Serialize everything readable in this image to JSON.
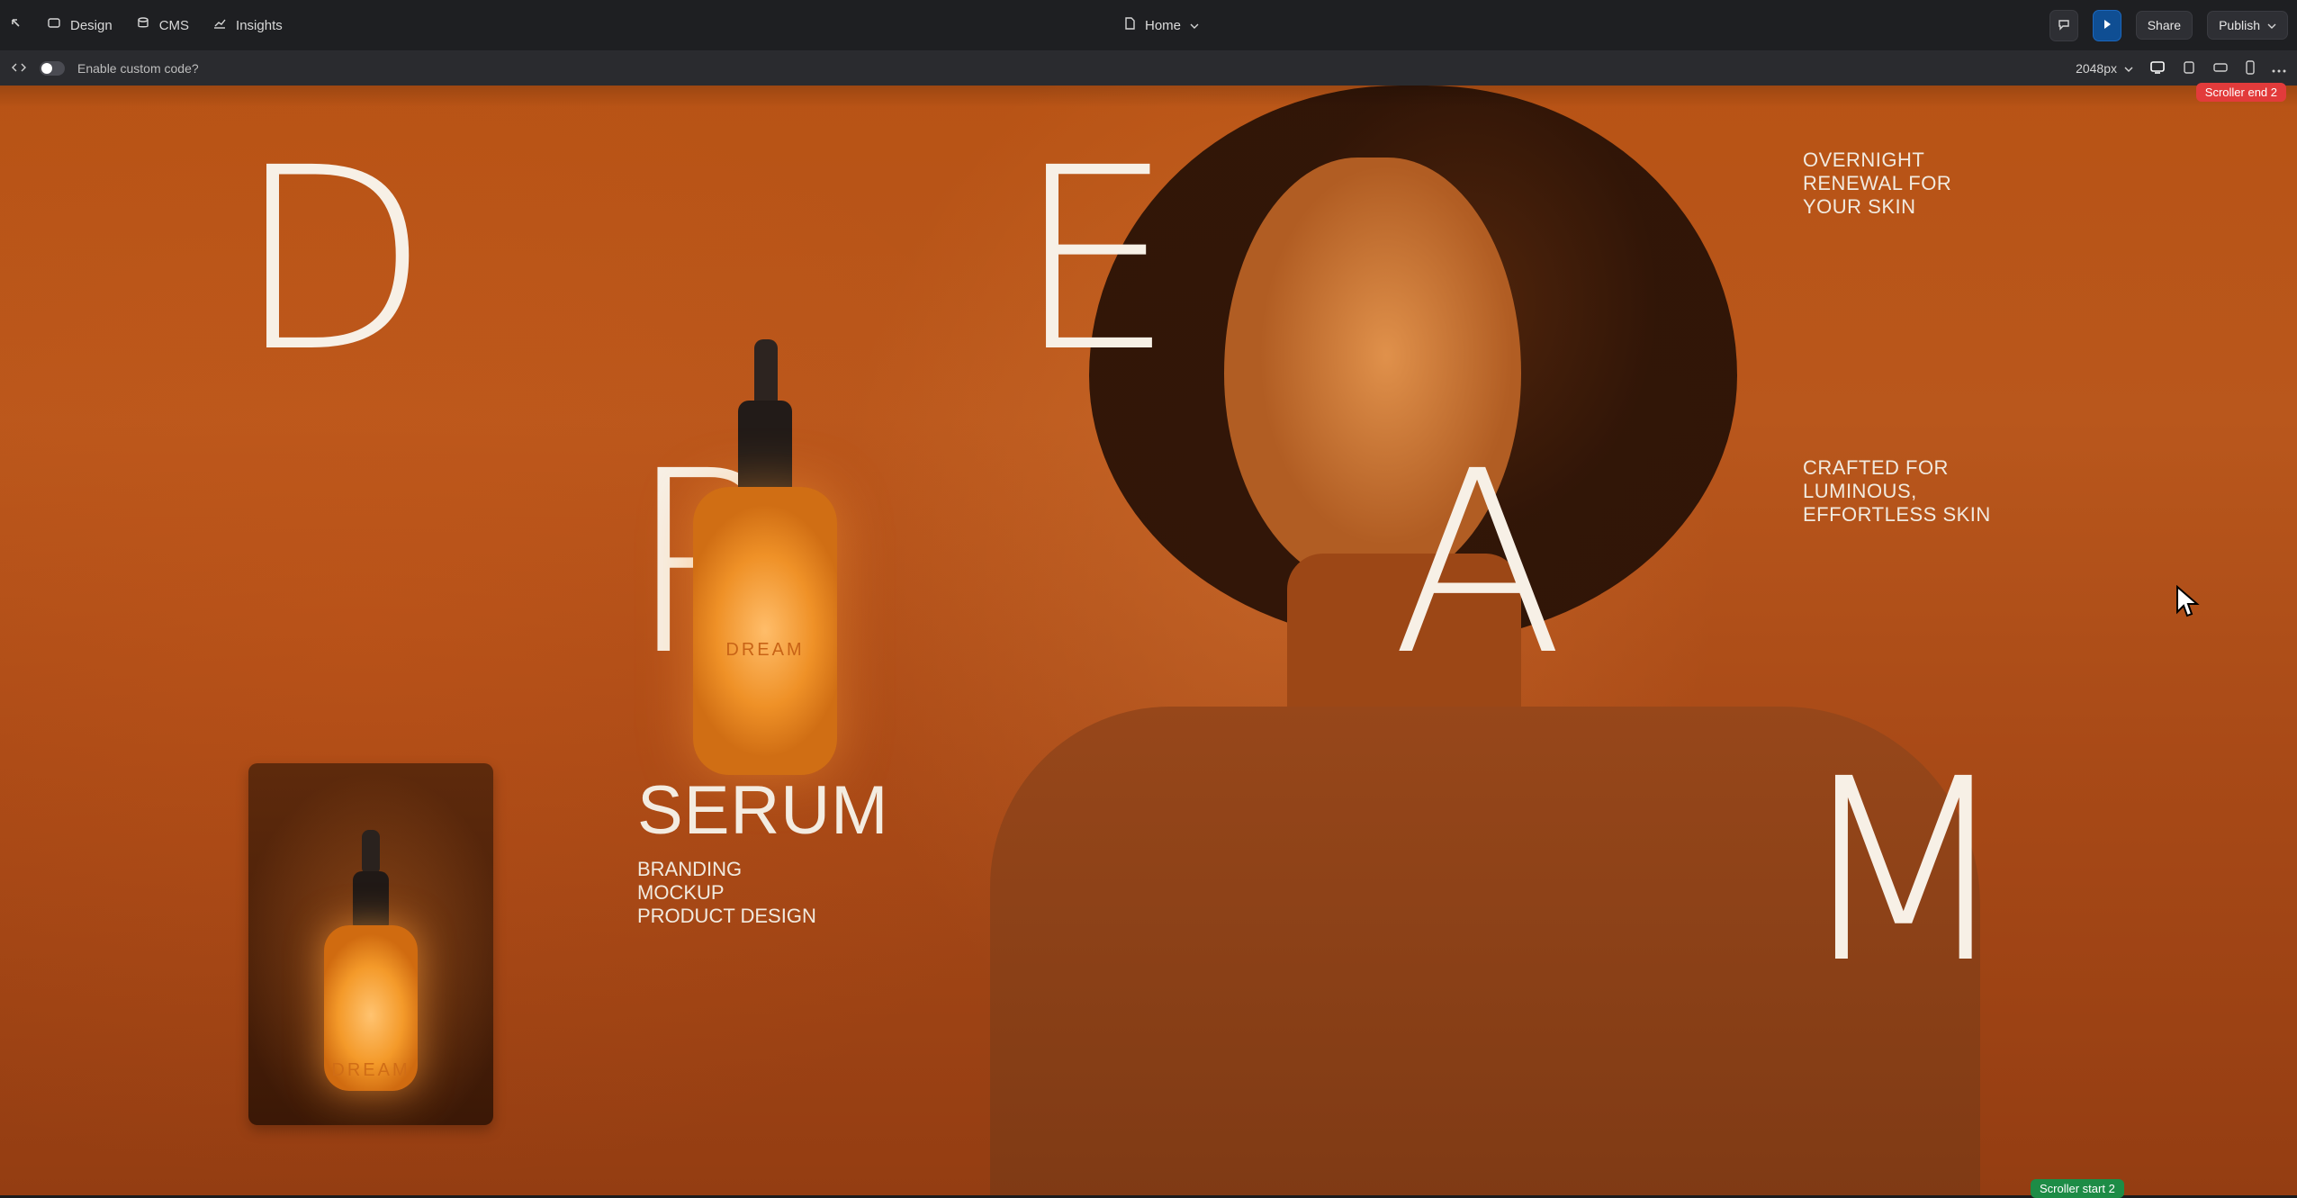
{
  "toolbar": {
    "design_label": "Design",
    "cms_label": "CMS",
    "insights_label": "Insights",
    "page_label": "Home",
    "share_label": "Share",
    "publish_label": "Publish"
  },
  "subbar": {
    "custom_code_label": "Enable custom code?",
    "breakpoint": "2048px"
  },
  "canvas": {
    "letters": [
      "D",
      "E",
      "R",
      "A",
      "M"
    ],
    "tagline1": "OVERNIGHT\nRENEWAL FOR\nYOUR SKIN",
    "tagline2": "CRAFTED FOR\nLUMINOUS,\nEFFORTLESS SKIN",
    "serum_title": "SERUM",
    "serum_lines": [
      "BRANDING",
      "MOCKUP",
      "PRODUCT DESIGN"
    ],
    "bottle_label": "DREAM",
    "hand_bottle_label": "DREAM"
  },
  "tags": {
    "scroller_end": "Scroller end 2",
    "scroller_start": "Scroller start 2"
  },
  "icons": {
    "back": "arrow-up-left-icon",
    "design": "layout-icon",
    "cms": "database-icon",
    "insights": "chart-icon",
    "page": "file-icon",
    "chat": "chat-icon",
    "play": "play-icon",
    "code": "code-icon",
    "chevron": "chevron-down-icon",
    "desktop": "desktop-icon",
    "tablet": "tablet-icon",
    "mobile": "mobile-icon",
    "more": "more-icon"
  }
}
